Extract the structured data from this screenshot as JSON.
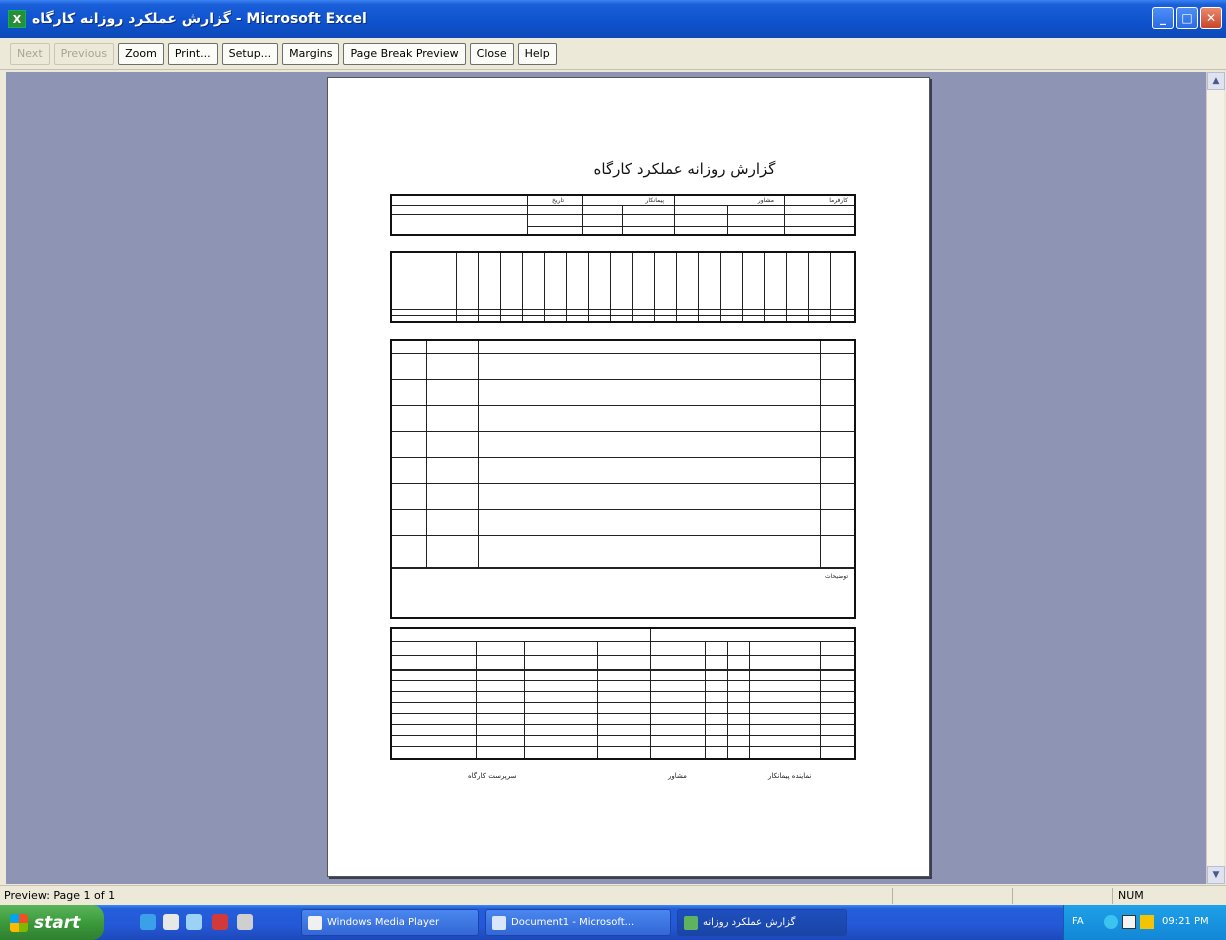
{
  "window": {
    "title": "گزارش عملکرد روزانه کارگاه - Microsoft Excel",
    "min_glyph": "_",
    "max_glyph": "□",
    "close_glyph": "✕"
  },
  "toolbar": {
    "next": "Next",
    "previous": "Previous",
    "zoom": "Zoom",
    "print": "Print...",
    "setup": "Setup...",
    "margins": "Margins",
    "page_break_preview": "Page Break Preview",
    "close": "Close",
    "help": "Help"
  },
  "report": {
    "title": "گزارش روزانه عملکرد کارگاه",
    "header_labels": [
      "کارفرما",
      "مشاور",
      "پیمانکار",
      "تاریخ"
    ],
    "lower_label": "توضیحات"
  },
  "signatures": {
    "left": "سرپرست کارگاه",
    "middle": "مشاور",
    "right": "نماینده پیمانکار"
  },
  "statusbar": {
    "text": "Preview: Page 1 of 1",
    "num": "NUM"
  },
  "taskbar": {
    "start": "start",
    "tasks": [
      "Windows Media Player",
      "Document1 - Microsoft...",
      "گزارش عملکرد روزانه"
    ],
    "language": "FA",
    "clock": "09:21 PM"
  },
  "colors": {
    "titlebar": "#0f53cf",
    "workspace": "#8e94b4",
    "taskbar": "#245edb",
    "start": "#3c9a3c"
  }
}
